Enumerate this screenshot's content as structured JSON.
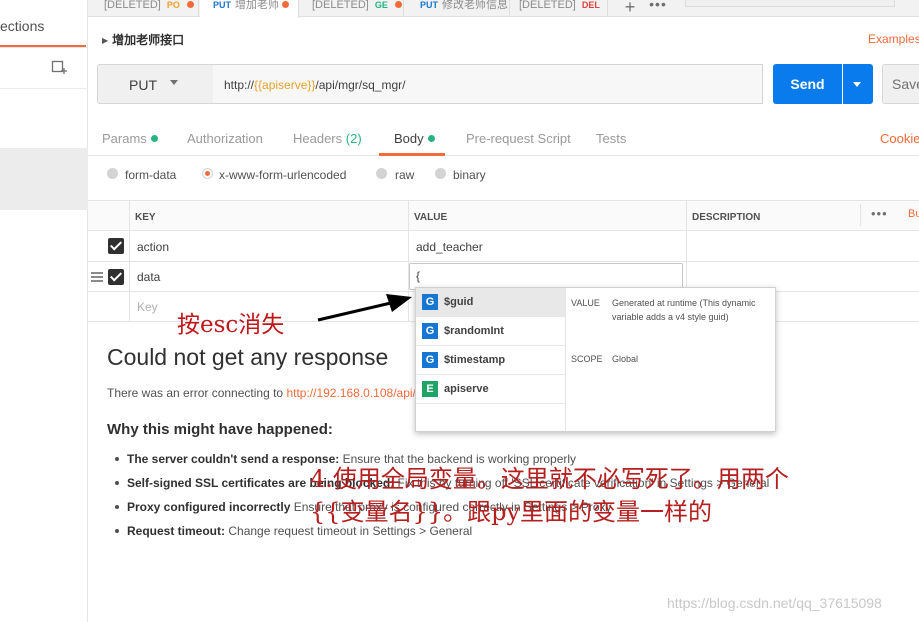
{
  "sidebar": {
    "tab_label": "ections"
  },
  "tabs": [
    {
      "method": "",
      "label": "[DELETED]",
      "method_tag": "PO"
    },
    {
      "method": "PUT",
      "label": "增加老师",
      "method_tag": ""
    },
    {
      "method": "",
      "label": "[DELETED]",
      "method_tag": "GE"
    },
    {
      "method": "PUT",
      "label": "修改老师信息",
      "method_tag": ""
    },
    {
      "method": "",
      "label": "[DELETED]",
      "method_tag": "DEL"
    }
  ],
  "tabs_more": "•••",
  "tab_plus": "+",
  "request": {
    "title": "增加老师接口",
    "examples": "Examples",
    "method": "PUT",
    "url_prefix": "http://",
    "url_var": "{{apiserve}}",
    "url_suffix": "/api/mgr/sq_mgr/",
    "send": "Send",
    "save": "Save"
  },
  "req_tabs": {
    "params": "Params",
    "authorization": "Authorization",
    "headers": "Headers",
    "headers_count": "(2)",
    "body": "Body",
    "prerequest": "Pre-request Script",
    "tests": "Tests",
    "cookies": "Cookies"
  },
  "body_types": {
    "form_data": "form-data",
    "urlencoded": "x-www-form-urlencoded",
    "raw": "raw",
    "binary": "binary",
    "selected": "x-www-form-urlencoded"
  },
  "table": {
    "headers": {
      "key": "KEY",
      "value": "VALUE",
      "description": "DESCRIPTION"
    },
    "more": "•••",
    "bulk": "Bu",
    "rows": [
      {
        "key": "action",
        "value": "add_teacher",
        "checked": true
      },
      {
        "key": "data",
        "value": "{",
        "checked": true
      }
    ],
    "key_placeholder": "Key"
  },
  "autocomplete": {
    "items": [
      {
        "badge": "G",
        "name": "$guid",
        "color": "#1676d2"
      },
      {
        "badge": "G",
        "name": "$randomInt",
        "color": "#1676d2"
      },
      {
        "badge": "G",
        "name": "$timestamp",
        "color": "#1676d2"
      },
      {
        "badge": "E",
        "name": "apiserve",
        "color": "#21a366"
      }
    ],
    "value_label": "VALUE",
    "value_text": "Generated at runtime (This dynamic variable adds a v4 style guid)",
    "scope_label": "SCOPE",
    "scope_text": "Global"
  },
  "response": {
    "title": "Could not get any response",
    "error_prefix": "There was an error connecting to ",
    "error_link": "http://192.168.0.108/api/",
    "why_title": "Why this might have happened:",
    "reasons": [
      {
        "bold": "The server couldn't send a response:",
        "text": " Ensure that the backend is working properly"
      },
      {
        "bold": "Self-signed SSL certificates are being blocked:",
        "text": " Fix this by turning off 'SSL certificate verification' in Settings > General"
      },
      {
        "bold": "Proxy configured incorrectly",
        "text": " Ensure that proxy is configured correctly in Settings > Proxy"
      },
      {
        "bold": "Request timeout:",
        "text": " Change request timeout in Settings > General"
      }
    ]
  },
  "annotations": {
    "esc": "按esc消失",
    "note_line1": "4.使用全局变量。这里就不必写死了。用两个",
    "note_line2": "{{变量名}}。跟py里面的变量一样的"
  },
  "watermark": "https://blog.csdn.net/qq_37615098",
  "colors": {
    "accent": "#f26b3a",
    "send": "#097bed",
    "green": "#26b47f",
    "annotation": "#c0161a"
  }
}
